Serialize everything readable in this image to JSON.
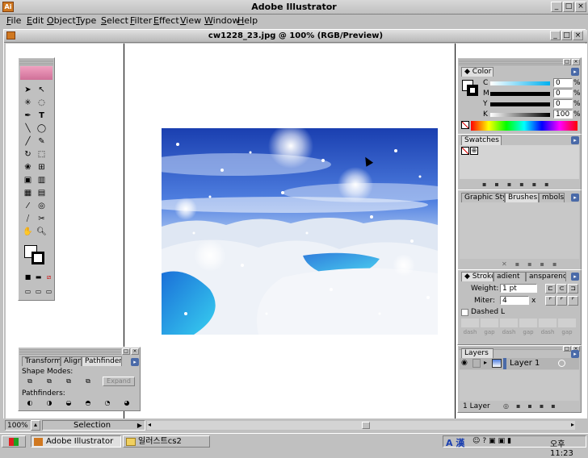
{
  "app": {
    "title": "Adobe Illustrator"
  },
  "menu": {
    "items": [
      "File",
      "Edit",
      "Object",
      "Type",
      "Select",
      "Filter",
      "Effect",
      "View",
      "Window",
      "Help"
    ]
  },
  "document": {
    "title": "cw1228_23.jpg @ 100% (RGB/Preview)"
  },
  "color_panel": {
    "tab": "Color",
    "channels": [
      {
        "label": "C",
        "value": "0"
      },
      {
        "label": "M",
        "value": "0"
      },
      {
        "label": "Y",
        "value": "0"
      },
      {
        "label": "K",
        "value": "100"
      }
    ],
    "unit": "%"
  },
  "swatches_panel": {
    "tab": "Swatches"
  },
  "brushes_panel": {
    "tabs": [
      "Graphic Sty",
      "Brushes",
      "mbols"
    ]
  },
  "stroke_panel": {
    "tabs": [
      "Stroke",
      "adient",
      "ansparency"
    ],
    "weight_label": "Weight:",
    "weight_value": "1 pt",
    "miter_label": "Miter:",
    "miter_value": "4",
    "miter_unit": "x",
    "dashed_label": "Dashed L",
    "dash_labels": [
      "dash",
      "gap",
      "dash",
      "gap",
      "dash",
      "gap"
    ]
  },
  "layers_panel": {
    "tab": "Layers",
    "layer_name": "Layer 1",
    "count_label": "1 Layer"
  },
  "pathfinder_panel": {
    "tabs": [
      "Transform",
      "Align",
      "Pathfinder"
    ],
    "shape_modes_label": "Shape Modes:",
    "expand_label": "Expand",
    "pathfinders_label": "Pathfinders:"
  },
  "status": {
    "zoom": "100%",
    "tool": "Selection"
  },
  "taskbar": {
    "start_label": "",
    "tasks": [
      "Adobe Illustrator",
      "일러스트cs2"
    ],
    "ime": "A 漢",
    "clock": "오후 11:23"
  },
  "colors": {
    "accent": "#4a6aa8",
    "sky": "#1a3fb0",
    "snow": "#e8eef8"
  }
}
